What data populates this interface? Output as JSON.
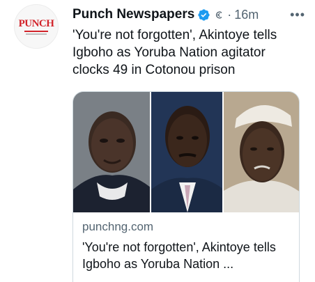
{
  "author": {
    "name": "Punch Newspapers",
    "avatar_logo": "PUNCH",
    "verified_color": "#1d9bf0"
  },
  "meta": {
    "separator": "·",
    "timestamp": "16m",
    "more": "•••"
  },
  "tweet": {
    "text": "'You're not forgotten', Akintoye tells Igboho as Yoruba Nation agitator clocks 49 in Cotonou prison"
  },
  "card": {
    "domain": "punchng.com",
    "title": "'You're not forgotten', Akintoye tells Igboho as Yoruba Nation ..."
  },
  "icons": {
    "verified": "verified-badge-icon",
    "grok": "grok-icon",
    "more": "more-options-icon"
  },
  "colors": {
    "brand_red": "#d2232a",
    "secondary_text": "#536471",
    "border": "#cfd9de"
  }
}
